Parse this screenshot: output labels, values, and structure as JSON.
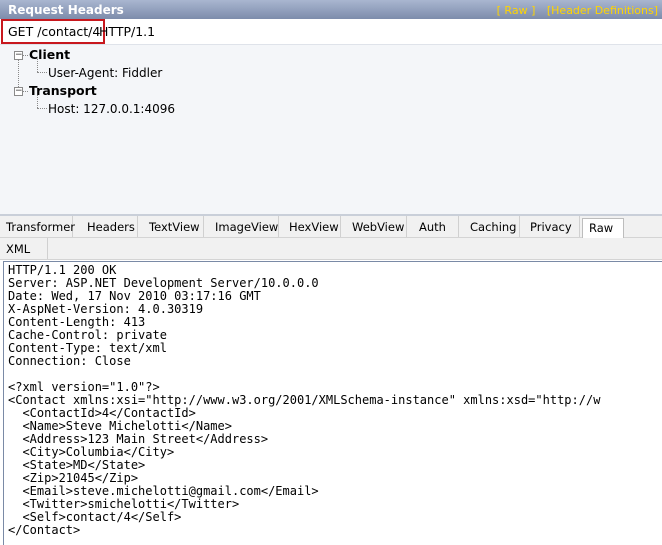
{
  "request_panel": {
    "title": "Request Headers",
    "raw_link": "[ Raw ]",
    "header_definitions_link": "[Header Definitions]",
    "request_line": {
      "method_url": "GET /contact/4",
      "protocol": "HTTP/1.1"
    },
    "tree": {
      "client": {
        "label": "Client",
        "headers": [
          "User-Agent: Fiddler"
        ]
      },
      "transport": {
        "label": "Transport",
        "headers": [
          "Host: 127.0.0.1:4096"
        ]
      }
    }
  },
  "response_tabs": [
    "Transformer",
    "Headers",
    "TextView",
    "ImageView",
    "HexView",
    "WebView",
    "Auth",
    "Caching",
    "Privacy",
    "Raw"
  ],
  "response_tabs_row2": [
    "XML"
  ],
  "active_tab": "Raw",
  "raw_response": [
    "HTTP/1.1 200 OK",
    "Server: ASP.NET Development Server/10.0.0.0",
    "Date: Wed, 17 Nov 2010 03:17:16 GMT",
    "X-AspNet-Version: 4.0.30319",
    "Content-Length: 413",
    "Cache-Control: private",
    "Content-Type: text/xml",
    "Connection: Close",
    "",
    "<?xml version=\"1.0\"?>",
    "<Contact xmlns:xsi=\"http://www.w3.org/2001/XMLSchema-instance\" xmlns:xsd=\"http://w",
    "  <ContactId>4</ContactId>",
    "  <Name>Steve Michelotti</Name>",
    "  <Address>123 Main Street</Address>",
    "  <City>Columbia</City>",
    "  <State>MD</State>",
    "  <Zip>21045</Zip>",
    "  <Email>steve.michelotti@gmail.com</Email>",
    "  <Twitter>smichelotti</Twitter>",
    "  <Self>contact/4</Self>",
    "</Contact>"
  ],
  "colors": {
    "header_gradient_top": "#a9b6d0",
    "header_gradient_bottom": "#7d8cab",
    "link": "#ffd400",
    "highlight_box": "#c8181e"
  }
}
